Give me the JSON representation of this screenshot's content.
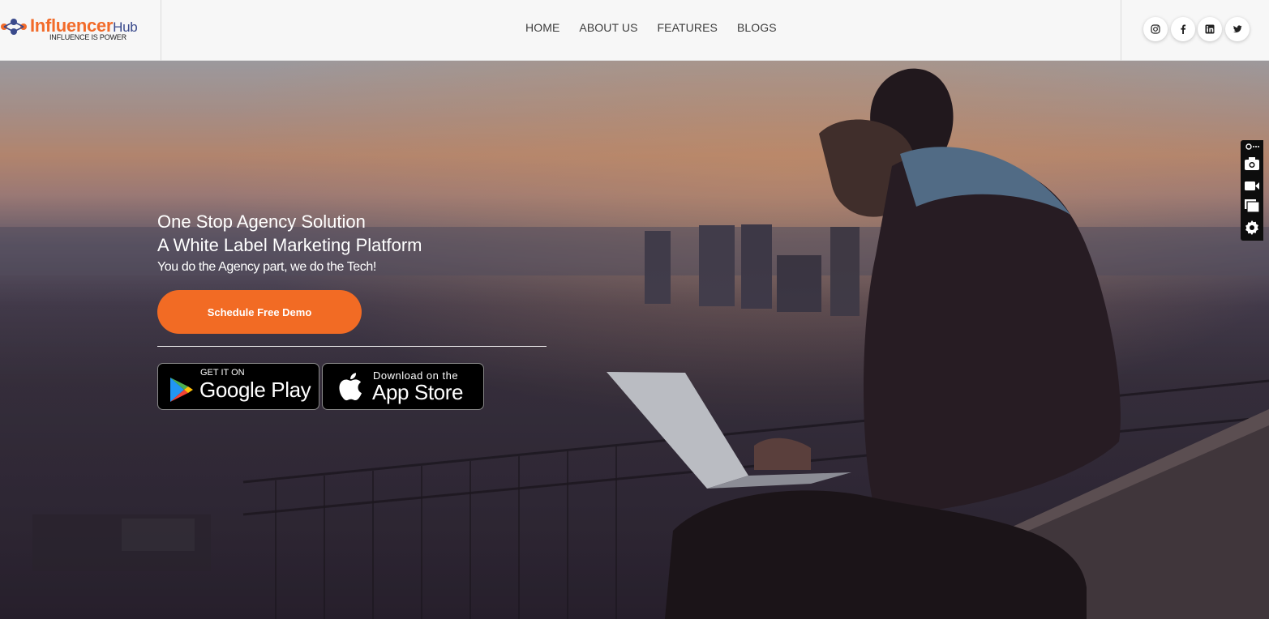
{
  "brand": {
    "name": "Influencer",
    "name_suffix": "Hub",
    "tagline": "INFLUENCE IS POWER"
  },
  "nav": {
    "items": [
      "HOME",
      "ABOUT US",
      "FEATURES",
      "BLOGS"
    ]
  },
  "social": {
    "items": [
      "instagram-icon",
      "facebook-icon",
      "linkedin-icon",
      "twitter-icon"
    ]
  },
  "hero": {
    "title_line1": "One Stop Agency Solution",
    "title_line2": "A White Label Marketing Platform",
    "subtitle": "You do the Agency part, we do the Tech!",
    "cta_label": "Schedule Free Demo"
  },
  "stores": {
    "google": {
      "small": "GET IT ON",
      "big": "Google Play"
    },
    "apple": {
      "small": "Download on the",
      "big": "App Store"
    }
  },
  "toolbar": {
    "items": [
      "link-icon",
      "camera-icon",
      "video-icon",
      "windows-icon",
      "settings-icon"
    ]
  },
  "colors": {
    "accent": "#f26b24",
    "brand_blue": "#3a4a8c",
    "header_bg": "#f7f7f7"
  }
}
